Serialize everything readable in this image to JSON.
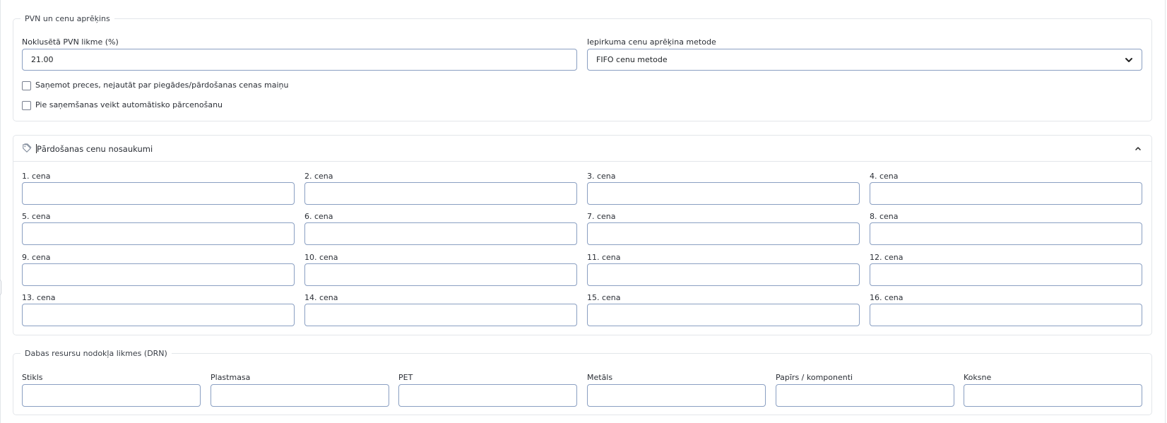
{
  "pvn_section": {
    "legend": "PVN un cenu aprēķins",
    "vat_label": "Noklusētā PVN likme (%)",
    "vat_value": "21.00",
    "method_label": "Iepirkuma cenu aprēķina metode",
    "method_selected": "FIFO cenu metode",
    "checkbox1_label": "Saņemot preces, nejautāt par piegādes/pārdošanas cenas maiņu",
    "checkbox2_label": "Pie saņemšanas veikt automātisko pārcenošanu"
  },
  "price_names_card": {
    "title": "Pārdošanas cenu nosaukumi",
    "icon": "tag-icon",
    "collapse_icon": "chevron-up-icon",
    "fields": [
      "1. cena",
      "2. cena",
      "3. cena",
      "4. cena",
      "5. cena",
      "6. cena",
      "7. cena",
      "8. cena",
      "9. cena",
      "10. cena",
      "11. cena",
      "12. cena",
      "13. cena",
      "14. cena",
      "15. cena",
      "16. cena"
    ]
  },
  "drn_section": {
    "legend": "Dabas resursu nodokļa likmes (DRN)",
    "fields": [
      "Stikls",
      "Plastmasa",
      "PET",
      "Metāls",
      "Papīrs / komponenti",
      "Koksne"
    ]
  }
}
